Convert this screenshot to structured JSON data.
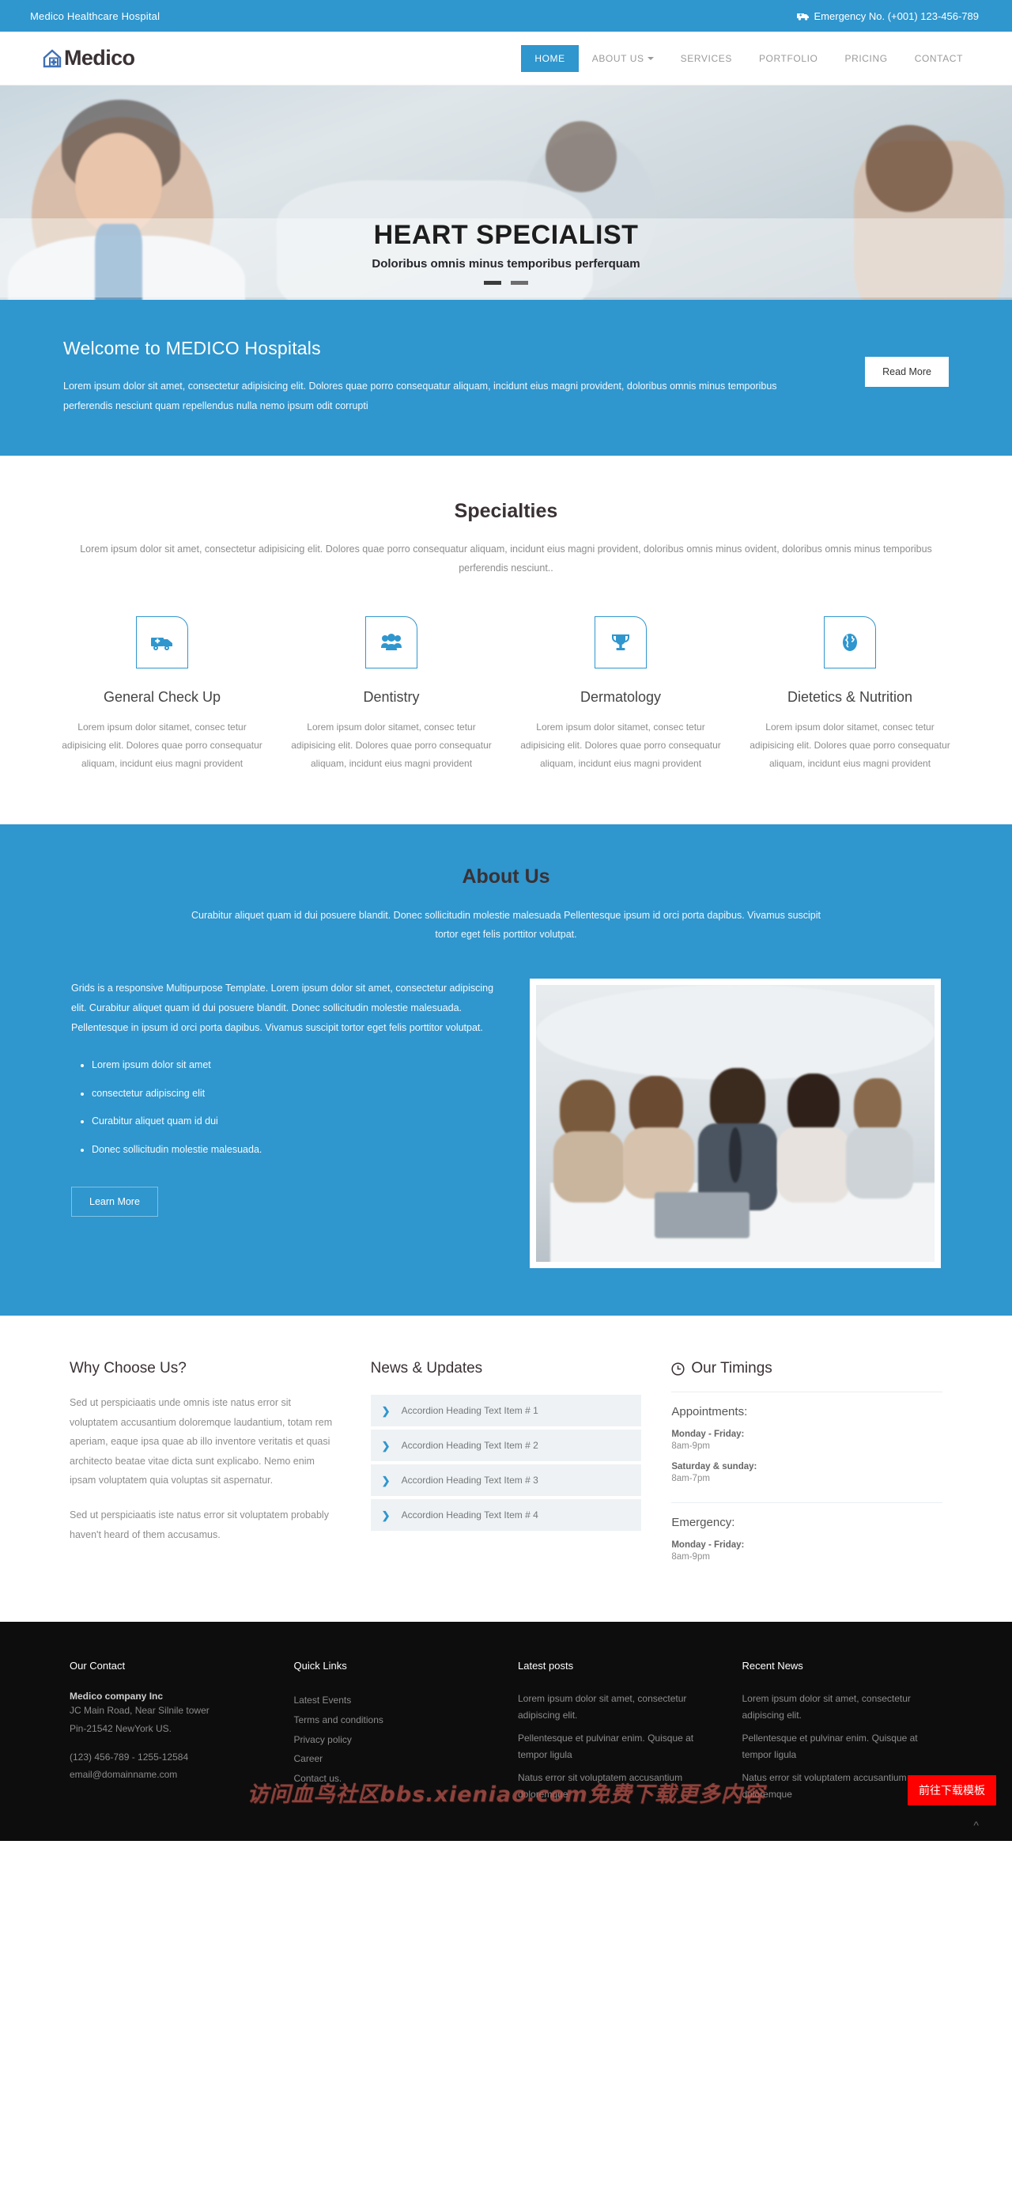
{
  "topbar": {
    "site_name": "Medico Healthcare Hospital",
    "emergency_label": "Emergency No. (+001) 123-456-789",
    "icon": "ambulance-icon",
    "bg_color": "#2f96ce"
  },
  "header": {
    "logo_icon": "house-plus-icon",
    "logo_text": "Medico",
    "nav": [
      {
        "label": "HOME",
        "active": true,
        "has_caret": false
      },
      {
        "label": "ABOUT US",
        "active": false,
        "has_caret": true
      },
      {
        "label": "SERVICES",
        "active": false,
        "has_caret": false
      },
      {
        "label": "PORTFOLIO",
        "active": false,
        "has_caret": false
      },
      {
        "label": "PRICING",
        "active": false,
        "has_caret": false
      },
      {
        "label": "CONTACT",
        "active": false,
        "has_caret": false
      }
    ]
  },
  "hero": {
    "title": "HEART SPECIALIST",
    "subtitle": "Doloribus omnis minus temporibus perferquam",
    "slides_total": 2,
    "active_slide": 1
  },
  "welcome": {
    "heading": "Welcome to MEDICO Hospitals",
    "paragraph": "Lorem ipsum dolor sit amet, consectetur adipisicing elit. Dolores quae porro consequatur aliquam, incidunt eius magni provident, doloribus omnis minus temporibus perferendis nesciunt quam repellendus nulla nemo ipsum odit corrupti",
    "button_label": "Read More"
  },
  "specialties": {
    "title": "Specialties",
    "subtitle": "Lorem ipsum dolor sit amet, consectetur adipisicing elit. Dolores quae porro consequatur aliquam, incidunt eius magni provident, doloribus omnis minus ovident, doloribus omnis minus temporibus perferendis nesciunt..",
    "items": [
      {
        "icon": "ambulance-icon",
        "name": "General Check Up",
        "desc": "Lorem ipsum dolor sitamet, consec tetur adipisicing elit. Dolores quae porro consequatur aliquam, incidunt eius magni provident"
      },
      {
        "icon": "group-people-icon",
        "name": "Dentistry",
        "desc": "Lorem ipsum dolor sitamet, consec tetur adipisicing elit. Dolores quae porro consequatur aliquam, incidunt eius magni provident"
      },
      {
        "icon": "trophy-icon",
        "name": "Dermatology",
        "desc": "Lorem ipsum dolor sitamet, consec tetur adipisicing elit. Dolores quae porro consequatur aliquam, incidunt eius magni provident"
      },
      {
        "icon": "globe-icon",
        "name": "Dietetics & Nutrition",
        "desc": "Lorem ipsum dolor sitamet, consec tetur adipisicing elit. Dolores quae porro consequatur aliquam, incidunt eius magni provident"
      }
    ]
  },
  "about": {
    "title": "About Us",
    "subtitle": "Curabitur aliquet quam id dui posuere blandit. Donec sollicitudin molestie malesuada Pellentesque ipsum id orci porta dapibus. Vivamus suscipit tortor eget felis porttitor volutpat.",
    "paragraph": "Grids is a responsive Multipurpose Template. Lorem ipsum dolor sit amet, consectetur adipiscing elit. Curabitur aliquet quam id dui posuere blandit. Donec sollicitudin molestie malesuada. Pellentesque in ipsum id orci porta dapibus. Vivamus suscipit tortor eget felis porttitor volutpat.",
    "bullets": [
      "Lorem ipsum dolor sit amet",
      "consectetur adipiscing elit",
      "Curabitur aliquet quam id dui",
      "Donec sollicitudin molestie malesuada."
    ],
    "button_label": "Learn More",
    "image_alt": "business-meeting-photo"
  },
  "why": {
    "heading": "Why Choose Us?",
    "paragraph1": "Sed ut perspiciaatis unde omnis iste natus error sit voluptatem accusantium doloremque laudantium, totam rem aperiam, eaque ipsa quae ab illo inventore veritatis et quasi architecto beatae vitae dicta sunt explicabo. Nemo enim ipsam voluptatem quia voluptas sit aspernatur.",
    "paragraph2": "Sed ut perspiciaatis iste natus error sit voluptatem probably haven't heard of them accusamus."
  },
  "news": {
    "heading": "News & Updates",
    "items": [
      "Accordion Heading Text Item # 1",
      "Accordion Heading Text Item # 2",
      "Accordion Heading Text Item # 3",
      "Accordion Heading Text Item # 4"
    ]
  },
  "timings": {
    "heading": "Our Timings",
    "icon": "clock-icon",
    "blocks": [
      {
        "kind": "Appointments:",
        "rows": [
          {
            "day": "Monday - Friday:",
            "hours": "8am-9pm"
          },
          {
            "day": "Saturday & sunday:",
            "hours": "8am-7pm"
          }
        ]
      },
      {
        "kind": "Emergency:",
        "rows": [
          {
            "day": "Monday - Friday:",
            "hours": "8am-9pm"
          }
        ]
      }
    ]
  },
  "footer": {
    "contact": {
      "heading": "Our Contact",
      "company": "Medico company Inc",
      "address1": "JC Main Road, Near Silnile tower",
      "address2": "Pin-21542 NewYork US.",
      "phone": "(123) 456-789 - 1255-12584",
      "email": "email@domainname.com"
    },
    "quick_links": {
      "heading": "Quick Links",
      "links": [
        "Latest Events",
        "Terms and conditions",
        "Privacy policy",
        "Career",
        "Contact us."
      ]
    },
    "latest_posts": {
      "heading": "Latest posts",
      "posts": [
        "Lorem ipsum dolor sit amet, consectetur adipiscing elit.",
        "Pellentesque et pulvinar enim. Quisque at tempor ligula",
        "Natus error sit voluptatem accusantium doloremque"
      ]
    },
    "recent_news": {
      "heading": "Recent News",
      "posts": [
        "Lorem ipsum dolor sit amet, consectetur adipiscing elit.",
        "Pellentesque et pulvinar enim. Quisque at tempor ligula",
        "Natus error sit voluptatem accusantium doloremque"
      ]
    },
    "watermark": "访问血鸟社区bbs.xieniao.com免费下载更多内容",
    "download_button": "前往下载模板",
    "scroll_top_icon": "chevron-up-icon"
  }
}
